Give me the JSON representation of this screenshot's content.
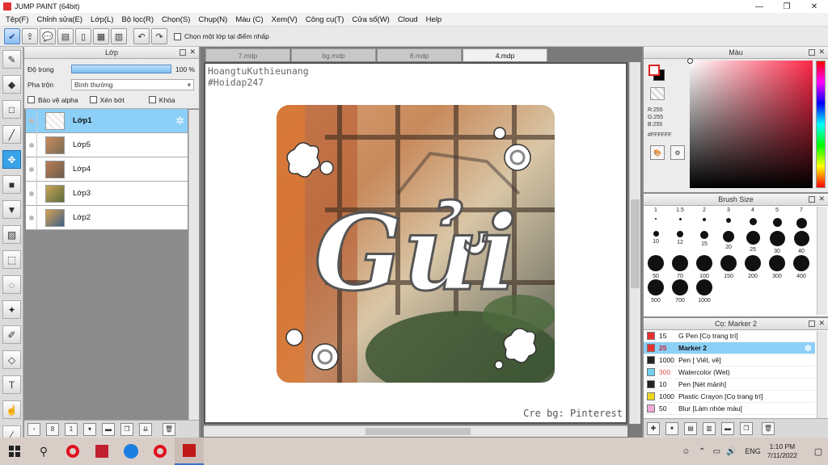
{
  "window": {
    "title": "JUMP PAINT (64bit)"
  },
  "menu": [
    "Tệp(F)",
    "Chỉnh sửa(E)",
    "Lớp(L)",
    "Bộ lọc(R)",
    "Chọn(S)",
    "Chụp(N)",
    "Màu (C)",
    "Xem(V)",
    "Công cụ(T)",
    "Cửa sổ(W)",
    "Cloud",
    "Help"
  ],
  "toolbar": {
    "select_layer_checkbox_label": "Chọn một lớp tại điểm nhấp"
  },
  "layer_panel": {
    "title": "Lớp",
    "opacity_label": "Độ trong",
    "opacity_value": "100 %",
    "opacity_fraction": 1.0,
    "blend_label": "Pha trộn",
    "blend_value": "Bình thường",
    "protect_alpha": "Bảo vệ alpha",
    "clipping": "Xén bớt",
    "lock": "Khóa",
    "layers": [
      {
        "name": "Lớp1",
        "active": true
      },
      {
        "name": "Lớp5",
        "active": false
      },
      {
        "name": "Lớp4",
        "active": false
      },
      {
        "name": "Lớp3",
        "active": false
      },
      {
        "name": "Lớp2",
        "active": false
      }
    ]
  },
  "tabs": [
    "7.mdp",
    "bg.mdp",
    "8.mdp",
    "4.mdp"
  ],
  "active_tab": "4.mdp",
  "canvas": {
    "watermark_line1": "HoangtuKuthieunang",
    "watermark_line2": "#Hoidap247",
    "artwork_text": "Gửi",
    "credit": "Cre bg: Pinterest"
  },
  "color_panel": {
    "title": "Màu",
    "r": "R:255",
    "g": "G:255",
    "b": "B:255",
    "hex": "#FFFFFF",
    "fg_color": "#ffffff",
    "accent": "#ff2848"
  },
  "brush_panel": {
    "title": "Brush Size",
    "sizes": [
      "1",
      "1.5",
      "2",
      "3",
      "4",
      "5",
      "7",
      "10",
      "12",
      "15",
      "20",
      "25",
      "30",
      "40",
      "50",
      "70",
      "100",
      "150",
      "200",
      "300",
      "400",
      "500",
      "700",
      "1000"
    ]
  },
  "preset_panel": {
    "title": "Cọ: Marker 2",
    "items": [
      {
        "size": "15",
        "name": "G Pen [Cọ trang trí]",
        "color": "#e83030"
      },
      {
        "size": "25",
        "name": "Marker 2",
        "color": "#e83030",
        "active": true
      },
      {
        "size": "1000",
        "name": "Pen [ Viết, vẽ]",
        "color": "#222222"
      },
      {
        "size": "300",
        "name": "Watercolor (Wet)",
        "color": "#6fd0f0"
      },
      {
        "size": "10",
        "name": "Pen [Nét mảnh]",
        "color": "#222222"
      },
      {
        "size": "1000",
        "name": "Plastic Crayon [Cọ trang trí]",
        "color": "#f0d820"
      },
      {
        "size": "50",
        "name": "Blur [Làm nhòe màu]",
        "color": "#f0a8d8"
      }
    ]
  },
  "taskbar": {
    "lang": "ENG",
    "time": "1:10 PM",
    "date": "7/11/2022"
  }
}
